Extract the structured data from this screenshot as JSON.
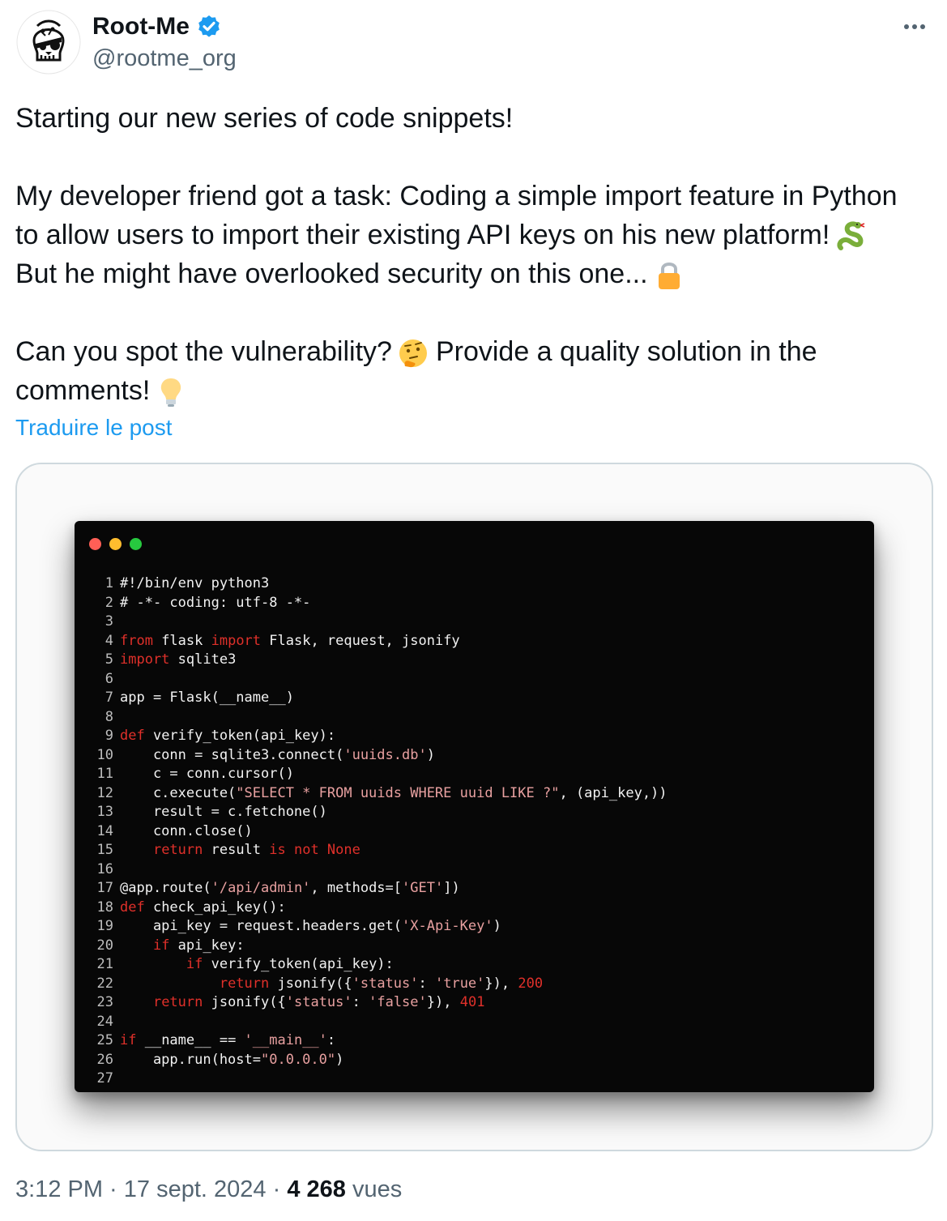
{
  "author": {
    "display_name": "Root-Me",
    "handle": "@rootme_org",
    "verified": true,
    "avatar_icon": "skull-pirate-logo"
  },
  "tweet": {
    "line1": "Starting our new series of code snippets!",
    "paragraph2_line1": "My developer friend got a task: Coding a simple import feature in Python",
    "paragraph2_line2": "to allow users to import their existing API keys on his new platform!",
    "paragraph2_line3": "But he might have overlooked security on this one...",
    "paragraph3_line1": "Can you spot the vulnerability?",
    "paragraph3_line1b": "Provide a quality solution in the",
    "paragraph3_line2": "comments!",
    "emojis": [
      "snake-emoji",
      "lock-emoji",
      "thinking-face-emoji",
      "light-bulb-emoji"
    ]
  },
  "translate_link": "Traduire le post",
  "code_snippet": {
    "window_dots": [
      "#ff5f56",
      "#ffbd2e",
      "#27c93f"
    ],
    "lines": [
      {
        "n": "1",
        "segs": [
          [
            "t",
            "#!/bin/env python3"
          ]
        ]
      },
      {
        "n": "2",
        "segs": [
          [
            "t",
            "# -*- coding: utf-8 -*-"
          ]
        ]
      },
      {
        "n": "3",
        "segs": []
      },
      {
        "n": "4",
        "segs": [
          [
            "k",
            "from"
          ],
          [
            "t",
            " flask "
          ],
          [
            "k",
            "import"
          ],
          [
            "t",
            " Flask, request, jsonify"
          ]
        ]
      },
      {
        "n": "5",
        "segs": [
          [
            "k",
            "import"
          ],
          [
            "t",
            " sqlite3"
          ]
        ]
      },
      {
        "n": "6",
        "segs": []
      },
      {
        "n": "7",
        "segs": [
          [
            "t",
            "app = Flask(__name__)"
          ]
        ]
      },
      {
        "n": "8",
        "segs": []
      },
      {
        "n": "9",
        "segs": [
          [
            "k",
            "def"
          ],
          [
            "t",
            " verify_token(api_key):"
          ]
        ]
      },
      {
        "n": "10",
        "segs": [
          [
            "t",
            "    conn = sqlite3.connect("
          ],
          [
            "s",
            "'uuids.db'"
          ],
          [
            "t",
            ")"
          ]
        ]
      },
      {
        "n": "11",
        "segs": [
          [
            "t",
            "    c = conn.cursor()"
          ]
        ]
      },
      {
        "n": "12",
        "segs": [
          [
            "t",
            "    c.execute("
          ],
          [
            "s",
            "\"SELECT * FROM uuids WHERE uuid LIKE ?\""
          ],
          [
            "t",
            ", (api_key,))"
          ]
        ]
      },
      {
        "n": "13",
        "segs": [
          [
            "t",
            "    result = c.fetchone()"
          ]
        ]
      },
      {
        "n": "14",
        "segs": [
          [
            "t",
            "    conn.close()"
          ]
        ]
      },
      {
        "n": "15",
        "segs": [
          [
            "t",
            "    "
          ],
          [
            "k",
            "return"
          ],
          [
            "t",
            " result "
          ],
          [
            "k",
            "is not None"
          ]
        ]
      },
      {
        "n": "16",
        "segs": []
      },
      {
        "n": "17",
        "segs": [
          [
            "t",
            "@app.route("
          ],
          [
            "s",
            "'/api/admin'"
          ],
          [
            "t",
            ", methods=["
          ],
          [
            "s",
            "'GET'"
          ],
          [
            "t",
            "])"
          ]
        ]
      },
      {
        "n": "18",
        "segs": [
          [
            "k",
            "def"
          ],
          [
            "t",
            " check_api_key():"
          ]
        ]
      },
      {
        "n": "19",
        "segs": [
          [
            "t",
            "    api_key = request.headers.get("
          ],
          [
            "s",
            "'X-Api-Key'"
          ],
          [
            "t",
            ")"
          ]
        ]
      },
      {
        "n": "20",
        "segs": [
          [
            "t",
            "    "
          ],
          [
            "k",
            "if"
          ],
          [
            "t",
            " api_key:"
          ]
        ]
      },
      {
        "n": "21",
        "segs": [
          [
            "t",
            "        "
          ],
          [
            "k",
            "if"
          ],
          [
            "t",
            " verify_token(api_key):"
          ]
        ]
      },
      {
        "n": "22",
        "segs": [
          [
            "t",
            "            "
          ],
          [
            "k",
            "return"
          ],
          [
            "t",
            " jsonify({"
          ],
          [
            "s",
            "'status'"
          ],
          [
            "t",
            ": "
          ],
          [
            "s",
            "'true'"
          ],
          [
            "t",
            "}), "
          ],
          [
            "k",
            "200"
          ]
        ]
      },
      {
        "n": "23",
        "segs": [
          [
            "t",
            "    "
          ],
          [
            "k",
            "return"
          ],
          [
            "t",
            " jsonify({"
          ],
          [
            "s",
            "'status'"
          ],
          [
            "t",
            ": "
          ],
          [
            "s",
            "'false'"
          ],
          [
            "t",
            "}), "
          ],
          [
            "k",
            "401"
          ]
        ]
      },
      {
        "n": "24",
        "segs": []
      },
      {
        "n": "25",
        "segs": [
          [
            "k",
            "if"
          ],
          [
            "t",
            " __name__ == "
          ],
          [
            "s",
            "'__main__'"
          ],
          [
            "t",
            ":"
          ]
        ]
      },
      {
        "n": "26",
        "segs": [
          [
            "t",
            "    app.run(host="
          ],
          [
            "s",
            "\"0.0.0.0\""
          ],
          [
            "t",
            ")"
          ]
        ]
      },
      {
        "n": "27",
        "segs": []
      }
    ]
  },
  "footer": {
    "time": "3:12 PM",
    "separator": " · ",
    "date": "17 sept. 2024",
    "views_count": "4 268",
    "views_label": "vues"
  }
}
